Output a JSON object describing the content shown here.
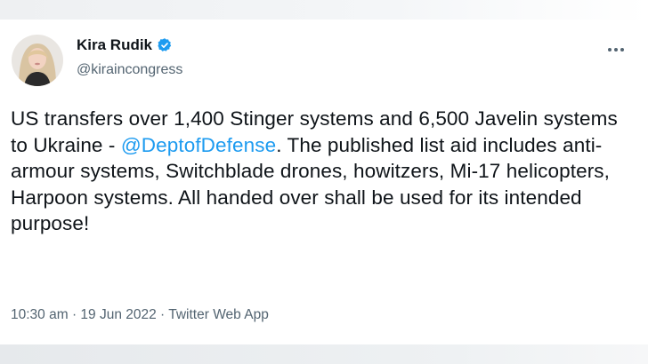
{
  "tweet": {
    "author": {
      "name": "Kira Rudik",
      "handle": "@kiraincongress",
      "verified": true
    },
    "text_before": "US transfers over 1,400 Stinger systems and 6,500 Javelin systems to Ukraine - ",
    "mention": "@DeptofDefense",
    "text_after": ". The published list aid includes anti-armour systems, Switchblade drones, howitzers, Mi-17 helicopters, Harpoon systems. All handed over shall be used for its intended purpose!",
    "time": "10:30 am",
    "date": "19 Jun 2022",
    "source": "Twitter Web App",
    "separator": " · "
  },
  "icons": {
    "verified": "verified-badge-icon",
    "more": "more-options-icon"
  },
  "colors": {
    "link": "#1d9bf0",
    "text": "#0f1419",
    "secondary": "#536471"
  }
}
